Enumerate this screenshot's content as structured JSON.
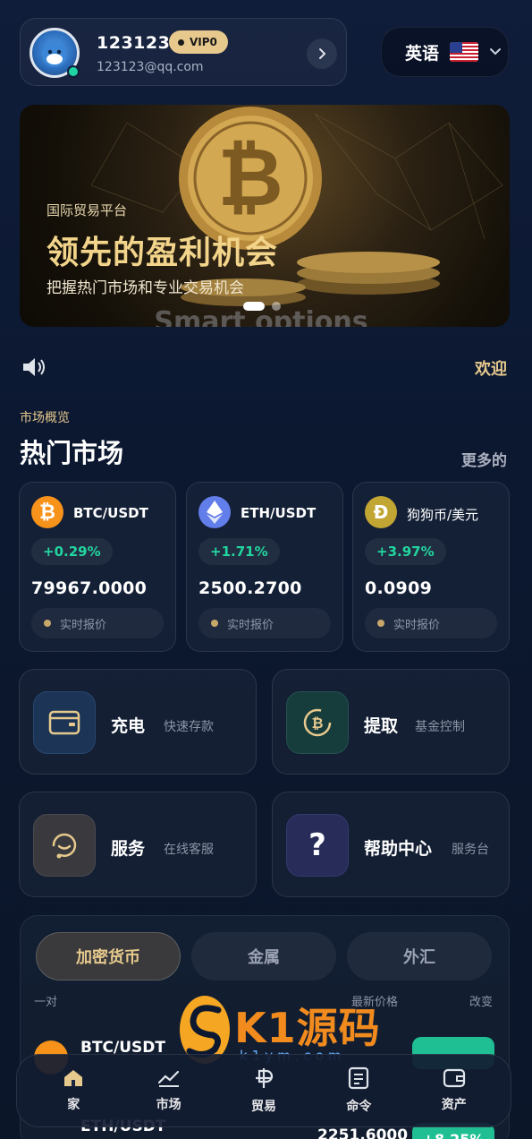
{
  "profile": {
    "username": "123123",
    "vip": "VIP0",
    "email": "123123@qq.com"
  },
  "language": {
    "label": "英语"
  },
  "banner": {
    "tag": "国际贸易平台",
    "title": "领先的盈利机会",
    "subtitle": "把握热门市场和专业交易机会"
  },
  "notice": {
    "text": "欢迎"
  },
  "section": {
    "tag": "市场概览",
    "title": "热门市场",
    "more": "更多的"
  },
  "markets": [
    {
      "pair": "BTC/USDT",
      "change": "+0.29%",
      "price": "79967.0000",
      "live": "实时报价"
    },
    {
      "pair": "ETH/USDT",
      "change": "+1.71%",
      "price": "2500.2700",
      "live": "实时报价"
    },
    {
      "pair": "狗狗币/美元",
      "change": "+3.97%",
      "price": "0.0909",
      "live": "实时报价"
    }
  ],
  "actions": [
    {
      "title": "充电",
      "sub": "快速存款"
    },
    {
      "title": "提取",
      "sub": "基金控制"
    },
    {
      "title": "服务",
      "sub": "在线客服"
    },
    {
      "title": "帮助中心",
      "sub": "服务台"
    }
  ],
  "tabs": [
    "加密货币",
    "金属",
    "外汇"
  ],
  "list_headers": {
    "pair": "一对",
    "price": "最新价格",
    "change": "改变"
  },
  "list_rows": [
    {
      "pair": "BTC/USDT"
    },
    {
      "pair": "ETH/USDT",
      "price": "2251.6000",
      "change": "+8.25%"
    }
  ],
  "watermark": {
    "brand": "K1源码",
    "url": "k1ym.com"
  },
  "nav": [
    "家",
    "市场",
    "贸易",
    "命令",
    "资产"
  ],
  "colors": {
    "accent_gold": "#e6c98d",
    "positive_green": "#22d69f",
    "background": "#0f1d3a"
  }
}
